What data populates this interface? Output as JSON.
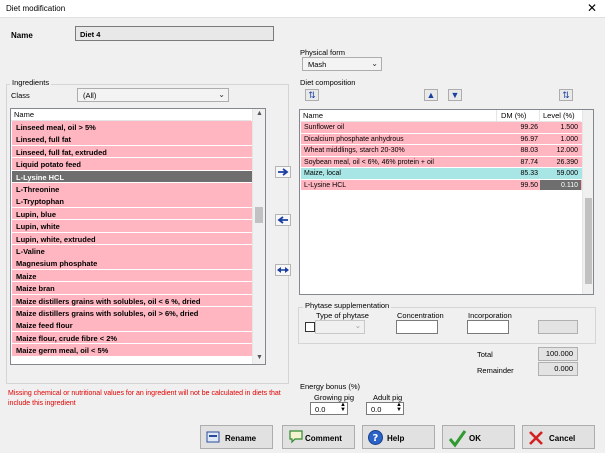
{
  "window": {
    "title": "Diet modification",
    "close": "✕"
  },
  "name": {
    "label": "Name",
    "value": "Diet 4"
  },
  "physical_form": {
    "label": "Physical form",
    "value": "Mash"
  },
  "ingredients": {
    "label": "Ingredients",
    "class_label": "Class",
    "class_value": "(All)",
    "col_name": "Name",
    "items": [
      "Linseed meal, oil > 5%",
      "Linseed, full fat",
      "Linseed, full fat, extruded",
      "Liquid potato feed",
      "L-Lysine HCL",
      "L-Threonine",
      "L-Tryptophan",
      "Lupin, blue",
      "Lupin, white",
      "Lupin, white, extruded",
      "L-Valine",
      "Magnesium phosphate",
      "Maize",
      "Maize bran",
      "Maize distillers grains with solubles, oil < 6 %, dried",
      "Maize distillers grains with solubles, oil > 6%, dried",
      "Maize feed flour",
      "Maize flour, crude fibre < 2%",
      "Maize germ meal, oil < 5%"
    ],
    "selected": "L-Lysine HCL"
  },
  "composition": {
    "label": "Diet composition",
    "cols": {
      "name": "Name",
      "dm": "DM (%)",
      "level": "Level (%)"
    },
    "rows": [
      {
        "name": "Sunflower oil",
        "dm": "99.26",
        "level": "1.500",
        "color": "#ffb6c1"
      },
      {
        "name": "Dicalcium phosphate anhydrous",
        "dm": "96.97",
        "level": "1.000",
        "color": "#ffb6c1"
      },
      {
        "name": "Wheat middlings, starch 20-30%",
        "dm": "88.03",
        "level": "12.000",
        "color": "#ffb6c1"
      },
      {
        "name": "Soybean meal, oil < 6%, 46% protein + oil",
        "dm": "87.74",
        "level": "26.390",
        "color": "#ffb6c1"
      },
      {
        "name": "Maize, local",
        "dm": "85.33",
        "level": "59.000",
        "color": "#a8e6e6"
      },
      {
        "name": "L-Lysine HCL",
        "dm": "99.50",
        "level": "0.110",
        "color": "#ffb6c1"
      }
    ]
  },
  "phytase": {
    "label": "Phytase supplementation",
    "type_label": "Type of phytase",
    "concentration_label": "Concentration",
    "incorporation_label": "Incorporation"
  },
  "totals": {
    "total_label": "Total",
    "total_value": "100.000",
    "remainder_label": "Remainder",
    "remainder_value": "0.000"
  },
  "warning": "Missing chemical or nutritional values for an ingredient will not be calculated in diets that include this ingredient",
  "energy": {
    "label": "Energy bonus (%)",
    "growing_label": "Growing pig",
    "growing_value": "0.0",
    "adult_label": "Adult pig",
    "adult_value": "0.0"
  },
  "buttons": {
    "rename": "Rename",
    "comment": "Comment",
    "help": "Help",
    "ok": "OK",
    "cancel": "Cancel"
  },
  "colors": {
    "pink": "#ffb6c1",
    "cyan": "#a8e6e6",
    "selected": "#6e6e6e"
  }
}
